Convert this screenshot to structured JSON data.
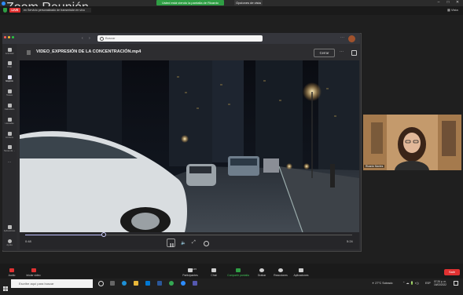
{
  "zoom": {
    "window_title": "Zoom Reunión",
    "share_banner": "Usted está viendo la pantalla de Ricardo Montes",
    "share_options": "Opciones de vista",
    "live_label": "LIVE",
    "stream_title": "en Servicio personalizado de transmisión en vivo",
    "view_label": "Vista"
  },
  "teams": {
    "search_placeholder": "Buscar",
    "rail": [
      {
        "label": "Actividad",
        "icon": "bell-icon"
      },
      {
        "label": "Chat",
        "icon": "chat-icon"
      },
      {
        "label": "Equipos",
        "icon": "teams-icon"
      },
      {
        "label": "Tareas",
        "icon": "tasks-icon"
      },
      {
        "label": "Calendario",
        "icon": "calendar-icon"
      },
      {
        "label": "Llamadas",
        "icon": "phone-icon"
      },
      {
        "label": "Archivos",
        "icon": "files-icon"
      },
      {
        "label": "Tareas de ...",
        "icon": "assignments-icon"
      },
      {
        "label": "...",
        "icon": "more-icon"
      },
      {
        "label": "Aplicaciones",
        "icon": "apps-icon"
      },
      {
        "label": "Ayuda",
        "icon": "help-icon"
      }
    ],
    "video_title": "VIDEO_EXPRESIÓN DE LA CONCENTRACIÓN.mp4",
    "close_label": "Cerrar",
    "time_current": "0:48",
    "time_total": "5:24",
    "progress": 0.24
  },
  "participant": {
    "name": "Ricardo Montes"
  },
  "toolbar": {
    "items": [
      {
        "label": "Audio",
        "icon": "mic-muted-icon"
      },
      {
        "label": "Iniciar video",
        "icon": "video-off-icon"
      },
      {
        "label": "Participantes",
        "icon": "participants-icon",
        "badge": "145"
      },
      {
        "label": "Chat",
        "icon": "chat-icon"
      },
      {
        "label": "Compartir pantalla",
        "icon": "share-screen-icon"
      },
      {
        "label": "Grabar",
        "icon": "record-icon"
      },
      {
        "label": "Reacciones",
        "icon": "reactions-icon"
      },
      {
        "label": "Aplicaciones",
        "icon": "apps-icon"
      }
    ],
    "end_label": "Salir"
  },
  "taskbar": {
    "search_placeholder": "Escribe aquí para buscar",
    "weather": "27°C Soleado",
    "language": "ESP",
    "time": "07:26 p. m.",
    "date": "16/03/2022"
  }
}
